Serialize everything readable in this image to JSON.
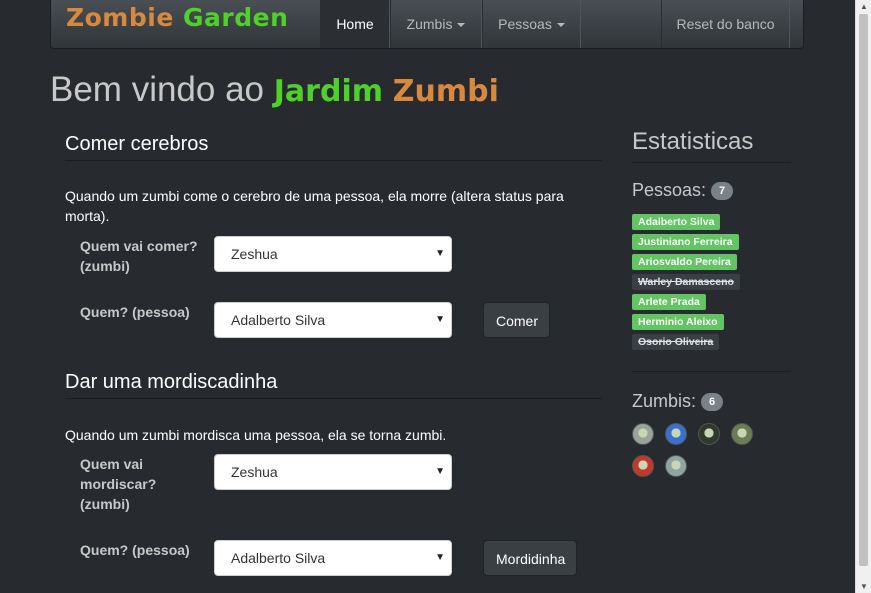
{
  "navbar": {
    "brand_part1": "Zombie",
    "brand_part2": "Garden",
    "home": "Home",
    "zumbis": "Zumbis",
    "pessoas": "Pessoas",
    "reset": "Reset do banco"
  },
  "headline": {
    "prefix": "Bem vindo ao",
    "word1": "Jardim",
    "word2": "Zumbi"
  },
  "eat": {
    "title": "Comer cerebros",
    "description": "Quando um zumbi come o cerebro de uma pessoa, ela morre (altera status para morta).",
    "zombie_label": "Quem vai comer? (zumbi)",
    "zombie_selected": "Zeshua",
    "person_label": "Quem? (pessoa)",
    "person_selected": "Adalberto Silva",
    "button": "Comer"
  },
  "bite": {
    "title": "Dar uma mordiscadinha",
    "description": "Quando um zumbi mordisca uma pessoa, ela se torna zumbi.",
    "zombie_label": "Quem vai mordiscar? (zumbi)",
    "zombie_selected": "Zeshua",
    "person_label": "Quem? (pessoa)",
    "person_selected": "Adalberto Silva",
    "button": "Mordidinha"
  },
  "stats": {
    "title": "Estatisticas",
    "people_label": "Pessoas:",
    "people_count": "7",
    "people": [
      {
        "name": "Adalberto Silva",
        "status": "alive"
      },
      {
        "name": "Justiniano Ferreira",
        "status": "alive"
      },
      {
        "name": "Ariosvaldo Pereira",
        "status": "alive"
      },
      {
        "name": "Warley Damasceno",
        "status": "dead"
      },
      {
        "name": "Arlete Prada",
        "status": "alive"
      },
      {
        "name": "Herminio Aleixo",
        "status": "alive"
      },
      {
        "name": "Osorio Oliveira",
        "status": "dead"
      }
    ],
    "zombies_label": "Zumbis:",
    "zombies_count": "6",
    "zombie_avatars": [
      {
        "icon": "zombie-avatar-icon",
        "color": "#9aa39a"
      },
      {
        "icon": "zombie-avatar-icon",
        "color": "#3a6fcf"
      },
      {
        "icon": "zombie-avatar-icon",
        "color": "#2f3a2a"
      },
      {
        "icon": "zombie-avatar-icon",
        "color": "#6a7d55"
      },
      {
        "icon": "zombie-avatar-icon",
        "color": "#c0392b"
      },
      {
        "icon": "zombie-avatar-icon",
        "color": "#8fa6a0"
      }
    ]
  },
  "colors": {
    "background": "#272b30",
    "alive": "#62c462",
    "brand_orange": "#d9893e",
    "brand_green": "#4fd12a"
  }
}
